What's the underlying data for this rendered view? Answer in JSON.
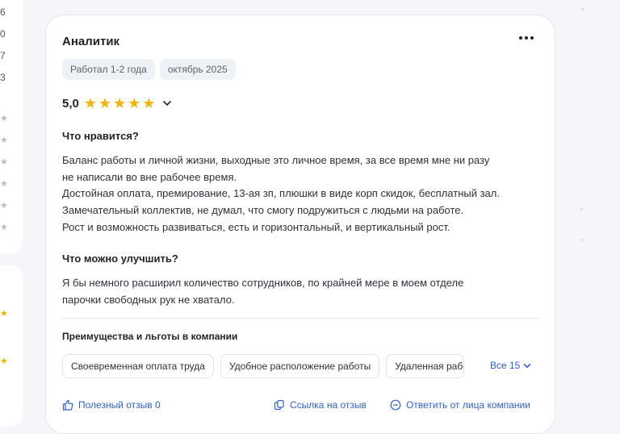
{
  "left_column": {
    "numbers": [
      "6",
      "0",
      "7",
      "3"
    ]
  },
  "review": {
    "title": "Аналитик",
    "tags": [
      "Работал 1-2 года",
      "октябрь 2025"
    ],
    "rating": "5,0",
    "stars_filled": 5,
    "likes_heading": "Что нравится?",
    "likes_lines": [
      "Баланс работы и личной жизни, выходные это личное время, за все время мне ни разу",
      "не написали во вне рабочее время.",
      "Достойная оплата, премирование, 13-ая зп, плюшки в виде корп скидок, бесплатный зал.",
      "Замечательный коллектив, не думал, что смогу подружиться с людьми на работе.",
      "Рост и возможность развиваться, есть и горизонтальный, и вертикальный рост."
    ],
    "improve_heading": "Что можно улучшить?",
    "improve_lines": [
      "Я бы немного расширил количество сотрудников, по крайней мере в моем отделе",
      "парочки свободных рук не хватало."
    ],
    "benefits_heading": "Преимущества и льготы в компании",
    "benefits": [
      "Своевременная оплата труда",
      "Удобное расположение работы",
      "Удаленная работа"
    ],
    "benefits_all_label": "Все 15",
    "footer": {
      "helpful": "Полезный отзыв 0",
      "link": "Ссылка на отзыв",
      "reply": "Ответить от лица компании"
    }
  },
  "colors": {
    "accent": "#2d5fd4",
    "star": "#f6b400",
    "tag_bg": "#eef1f5"
  }
}
